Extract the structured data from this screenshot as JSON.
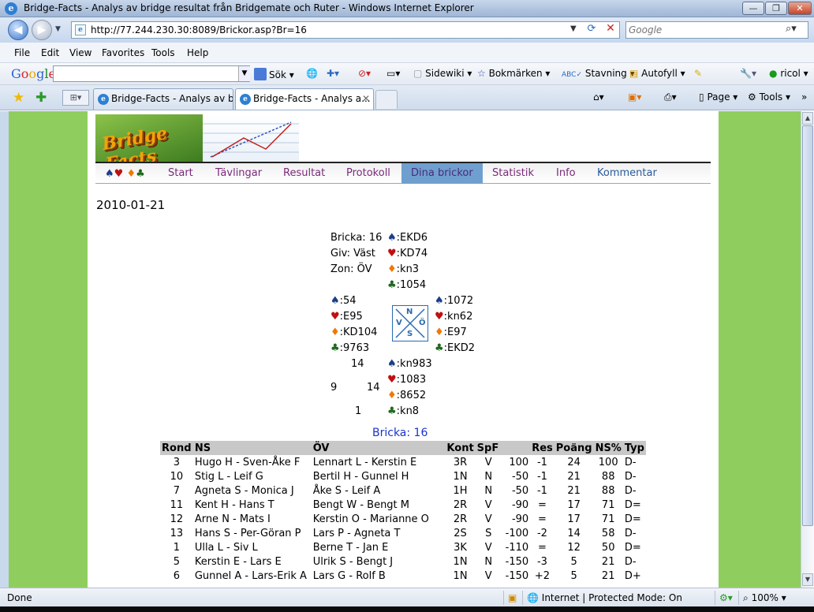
{
  "window": {
    "title": "Bridge-Facts - Analys av bridge resultat från Bridgemate och Ruter - Windows Internet Explorer",
    "minimize": "—",
    "restore": "❐",
    "close": "✕"
  },
  "address": {
    "url": "http://77.244.230.30:8089/Brickor.asp?Br=16",
    "search_placeholder": "Google"
  },
  "menu": [
    "File",
    "Edit",
    "View",
    "Favorites",
    "Tools",
    "Help"
  ],
  "google_bar": {
    "logo": "Google",
    "items": [
      "Sök ▾",
      "Sidewiki ▾",
      "Bokmärken ▾",
      "Stavning ▾",
      "Autofyll ▾",
      "ricol ▾"
    ]
  },
  "tabs": [
    {
      "label": "Bridge-Facts - Analys av br..."
    },
    {
      "label": "Bridge-Facts - Analys a..."
    }
  ],
  "commands": {
    "page": "Page ▾",
    "tools": "Tools ▾"
  },
  "site": {
    "logo_text": "Bridge Facts",
    "nav": [
      "Start",
      "Tävlingar",
      "Resultat",
      "Protokoll",
      "Dina brickor",
      "Statistik",
      "Info",
      "Kommentar"
    ],
    "active_nav": "Dina brickor",
    "date": "2010-01-21"
  },
  "deal": {
    "info": {
      "bricka": "Bricka: 16",
      "giv": "Giv: Väst",
      "zon": "Zon: ÖV"
    },
    "north": {
      "spades": ":EKD6",
      "hearts": ":KD74",
      "diamonds": ":kn3",
      "clubs": ":1054"
    },
    "west": {
      "spades": ":54",
      "hearts": ":E95",
      "diamonds": ":KD104",
      "clubs": ":9763"
    },
    "east": {
      "spades": ":1072",
      "hearts": ":kn62",
      "diamonds": ":E97",
      "clubs": ":EKD2"
    },
    "south": {
      "spades": ":kn983",
      "hearts": ":1083",
      "diamonds": ":8652",
      "clubs": ":kn8"
    },
    "compass": {
      "n": "N",
      "s": "S",
      "v": "V",
      "o": "Ö"
    },
    "tricks": {
      "top": "14",
      "left": "9",
      "right": "14",
      "bottom": "1"
    },
    "title": "Bricka: 16"
  },
  "table": {
    "headers": [
      "Rond",
      "NS",
      "ÖV",
      "Kont",
      "SpF",
      "",
      "Res",
      "Poäng",
      "NS%",
      "Typ"
    ],
    "rows": [
      [
        "3",
        "Hugo H - Sven-Åke F",
        "Lennart L - Kerstin E",
        "3R",
        "V",
        "100",
        "-1",
        "24",
        "100",
        "D-"
      ],
      [
        "10",
        "Stig L - Leif G",
        "Bertil H - Gunnel H",
        "1N",
        "N",
        "-50",
        "-1",
        "21",
        "88",
        "D-"
      ],
      [
        "7",
        "Agneta S - Monica J",
        "Åke S - Leif A",
        "1H",
        "N",
        "-50",
        "-1",
        "21",
        "88",
        "D-"
      ],
      [
        "11",
        "Kent H - Hans T",
        "Bengt W - Bengt M",
        "2R",
        "V",
        "-90",
        "=",
        "17",
        "71",
        "D="
      ],
      [
        "12",
        "Arne N - Mats I",
        "Kerstin O - Marianne O",
        "2R",
        "V",
        "-90",
        "=",
        "17",
        "71",
        "D="
      ],
      [
        "13",
        "Hans S - Per-Göran P",
        "Lars P - Agneta T",
        "2S",
        "S",
        "-100",
        "-2",
        "14",
        "58",
        "D-"
      ],
      [
        "1",
        "Ulla L - Siv L",
        "Berne T - Jan E",
        "3K",
        "V",
        "-110",
        "=",
        "12",
        "50",
        "D="
      ],
      [
        "5",
        "Kerstin E - Lars E",
        "Ulrik S - Bengt J",
        "1N",
        "N",
        "-150",
        "-3",
        "5",
        "21",
        "D-"
      ],
      [
        "6",
        "Gunnel A - Lars-Erik A",
        "Lars G - Rolf B",
        "1N",
        "V",
        "-150",
        "+2",
        "5",
        "21",
        "D+"
      ]
    ]
  },
  "status": {
    "left": "Done",
    "zone": "Internet | Protected Mode: On",
    "zoom": "100%"
  }
}
